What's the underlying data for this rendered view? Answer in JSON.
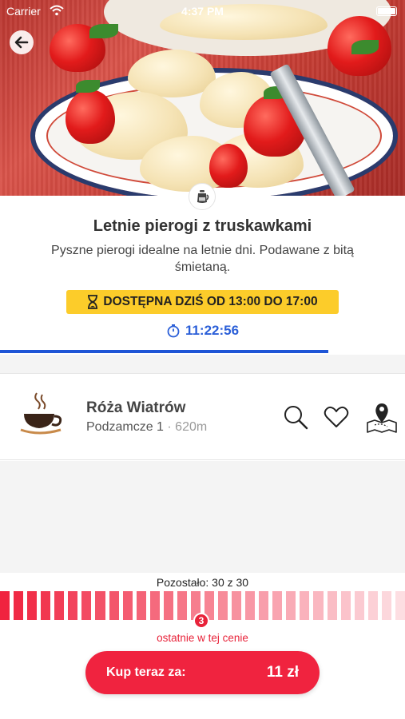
{
  "status_bar": {
    "carrier": "Carrier",
    "time": "4:37 PM"
  },
  "offer": {
    "title": "Letnie pierogi z truskawkami",
    "description": "Pyszne pierogi idealne na letnie dni. Podawane z bitą śmietaną.",
    "availability": "DOSTĘPNA DZIŚ OD 13:00 DO 17:00",
    "countdown": "11:22:56",
    "countdown_progress": 0.81
  },
  "restaurant": {
    "name": "Róża Wiatrów",
    "address": "Podzamcze 1",
    "separator": "·",
    "distance": "620m"
  },
  "stock": {
    "remaining_text": "Pozostało: 30 z 30",
    "badge": "3",
    "last_price_text": "ostatnie w tej cenie",
    "segments": 30
  },
  "purchase": {
    "label": "Kup teraz za:",
    "price": "11 zł"
  },
  "colors": {
    "accent_red": "#f0233f",
    "availability_yellow": "#fccc2a",
    "timer_blue": "#2b5fd8",
    "progress_blue": "#1e55d6"
  },
  "icons": {
    "back": "arrow-left-icon",
    "badge": "coffee-pot-icon",
    "hourglass": "hourglass-icon",
    "stopwatch": "stopwatch-icon",
    "logo": "coffee-cup-icon",
    "search": "search-icon",
    "favorite": "heart-icon",
    "map": "map-pin-icon"
  }
}
